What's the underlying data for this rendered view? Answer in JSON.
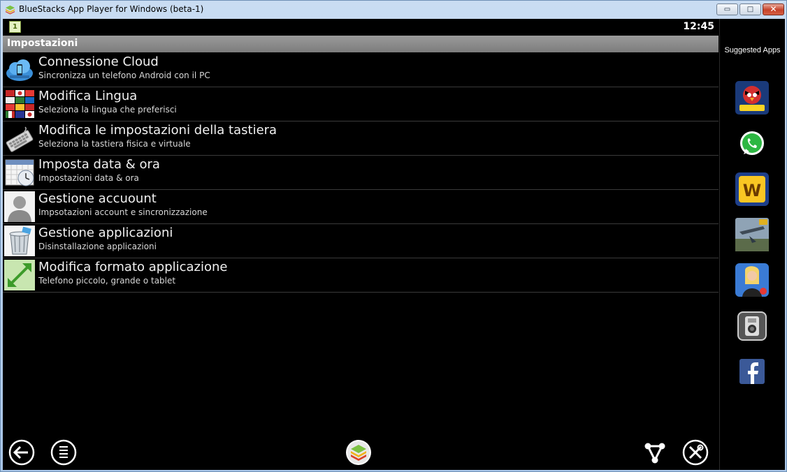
{
  "window": {
    "title": "BlueStacks App Player for Windows (beta-1)",
    "min_label": "▭",
    "max_label": "□",
    "close_label": "✕"
  },
  "status": {
    "notification_badge": "1",
    "clock": "12:45"
  },
  "header": {
    "title": "Impostazioni"
  },
  "settings": [
    {
      "title": "Connessione Cloud",
      "subtitle": "Sincronizza un telefono Android con il PC",
      "icon": "cloud-icon"
    },
    {
      "title": "Modifica Lingua",
      "subtitle": "Seleziona la lingua che preferisci",
      "icon": "flags-icon"
    },
    {
      "title": "Modifica le impostazioni della tastiera",
      "subtitle": "Seleziona la tastiera fisica e virtuale",
      "icon": "keyboard-icon"
    },
    {
      "title": "Imposta data & ora",
      "subtitle": "Impostazioni data & ora",
      "icon": "calendar-clock-icon"
    },
    {
      "title": "Gestione accuount",
      "subtitle": "Impsotazioni account e sincronizzazione",
      "icon": "user-icon"
    },
    {
      "title": "Gestione applicazioni",
      "subtitle": "Disinstallazione applicazioni",
      "icon": "trash-icon"
    },
    {
      "title": "Modifica formato applicazione",
      "subtitle": "Telefono piccolo, grande o tablet",
      "icon": "resize-icon"
    }
  ],
  "sidebar": {
    "label": "Suggested Apps",
    "apps": [
      "angry-birds-space-icon",
      "whatsapp-icon",
      "words-with-friends-icon",
      "war-game-icon",
      "fashion-game-icon",
      "camera-app-icon",
      "facebook-icon"
    ]
  },
  "navbar": [
    "back-icon",
    "menu-icon",
    "bluestacks-home-icon",
    "share-icon",
    "settings-tools-icon"
  ],
  "colors": {
    "background": "#000000",
    "header": "#8a8a8a",
    "text": "#f0f0f0",
    "window_frame": "#a9c6e8"
  }
}
